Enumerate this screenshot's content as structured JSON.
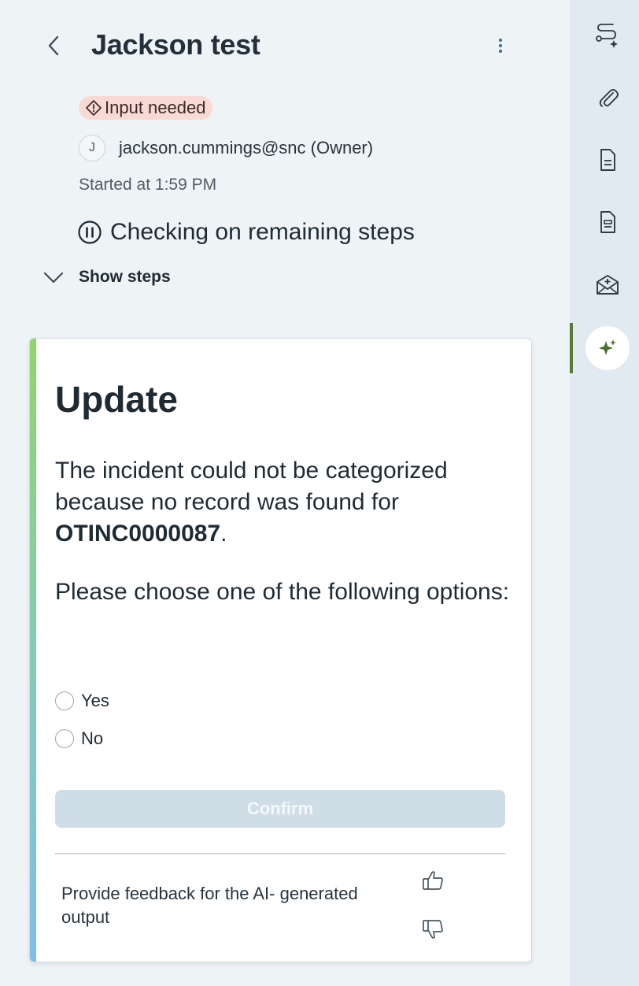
{
  "header": {
    "title": "Jackson test",
    "back_icon": "chevron-left-icon",
    "menu_icon": "more-vertical-icon"
  },
  "status_badge": {
    "label": "Input needed",
    "icon": "warning-diamond-icon",
    "color": "#f8d9d4"
  },
  "owner": {
    "avatar_initial": "J",
    "text": "jackson.cummings@snc (Owner)"
  },
  "started": "Started at 1:59 PM",
  "current_step": {
    "icon": "pause-circle-icon",
    "label": "Checking on remaining steps"
  },
  "show_steps_label": "Show steps",
  "card": {
    "title": "Update",
    "message_prefix": "The incident could not be categorized because no record was found for ",
    "record_id": "OTINC0000087",
    "message_suffix": ".",
    "question": "Please choose one of the following options:",
    "options": [
      "Yes",
      "No"
    ],
    "confirm_label": "Confirm",
    "feedback_text": "Provide feedback for the AI- generated output",
    "accent_colors": [
      "#8fd66a",
      "#7fbde8"
    ]
  },
  "rail": {
    "items": [
      {
        "icon": "workflow-sparkle-icon"
      },
      {
        "icon": "paperclip-icon"
      },
      {
        "icon": "document-icon"
      },
      {
        "icon": "document-lines-icon"
      },
      {
        "icon": "mail-add-icon"
      },
      {
        "icon": "sparkle-icon",
        "active": true
      }
    ],
    "active_color": "#5a7a3c"
  }
}
